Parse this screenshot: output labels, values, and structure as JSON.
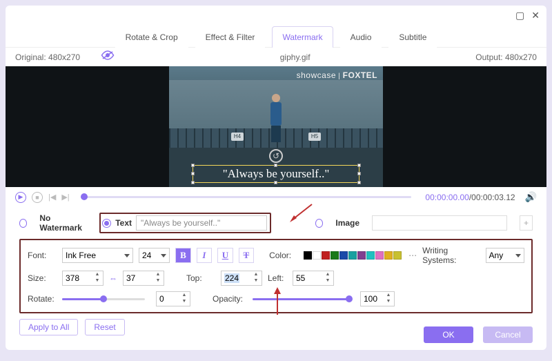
{
  "titlebar": {
    "max": "▢",
    "close": "✕"
  },
  "tabs": [
    "Rotate & Crop",
    "Effect & Filter",
    "Watermark",
    "Audio",
    "Subtitle"
  ],
  "active_tab": 2,
  "filebar": {
    "original": "Original: 480x270",
    "filename": "giphy.gif",
    "output": "Output: 480x270"
  },
  "preview": {
    "brand_a": "showcase",
    "brand_b": "FOXTEL",
    "pillL": "H4",
    "pillR": "H5",
    "wm_text": "\"Always be yourself..\""
  },
  "playbar": {
    "time_cur": "00:00:00.00",
    "time_total": "/00:00:03.12"
  },
  "watermark_row": {
    "no_wm": "No Watermark",
    "text_label": "Text",
    "text_value": "\"Always be yourself..\"",
    "image_label": "Image",
    "plus": "+"
  },
  "panel": {
    "font_label": "Font:",
    "font_family": "Ink Free",
    "font_size": "24",
    "color_label": "Color:",
    "colors": [
      "#000000",
      "#ffffff",
      "#c02020",
      "#1a7a1a",
      "#1a4aa8",
      "#1aa0a0",
      "#804090",
      "#20c0c0",
      "#e070c0",
      "#e0b020",
      "#c8c030"
    ],
    "writing_label": "Writing Systems:",
    "writing_value": "Any",
    "size_label": "Size:",
    "size_w": "378",
    "size_h": "37",
    "top_label": "Top:",
    "top_v": "224",
    "left_label": "Left:",
    "left_v": "55",
    "rotate_label": "Rotate:",
    "rotate_v": "0",
    "opacity_label": "Opacity:",
    "opacity_v": "100"
  },
  "buttons": {
    "apply": "Apply to All",
    "reset": "Reset",
    "ok": "OK",
    "cancel": "Cancel"
  },
  "fmt": {
    "b": "B",
    "i": "I",
    "u": "U",
    "s": "T"
  }
}
